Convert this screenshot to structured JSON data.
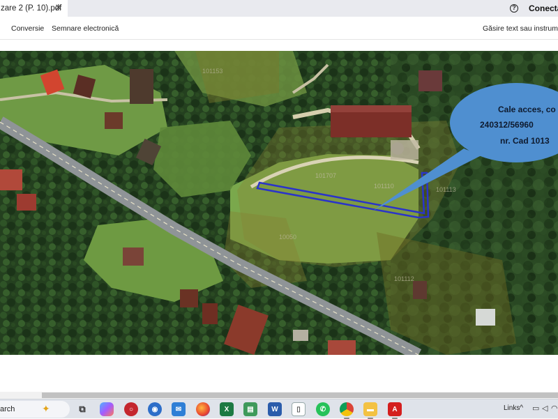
{
  "tab": {
    "title": "zare 2 (P. 10).pdf",
    "close_glyph": "✕"
  },
  "header": {
    "help_glyph": "?",
    "connect_label": "Conecta"
  },
  "toolbar": {
    "conversion": "Conversie",
    "esign": "Semnare electronică",
    "find": "Găsire text sau instrumente"
  },
  "map": {
    "callout_lines": [
      "Cale acces, co",
      "240312/56960",
      "nr. Cad 1013"
    ],
    "parcel_labels": [
      "101153",
      "101707",
      "101110",
      "101113",
      "10050",
      "101112"
    ],
    "access_path_color": "#2a34c9",
    "callout_color": "#4f8fd0"
  },
  "taskbar": {
    "search_label": "arch",
    "links_label": "Links",
    "apps": [
      {
        "name": "task-view-icon"
      },
      {
        "name": "copilot-icon"
      },
      {
        "name": "office-icon"
      },
      {
        "name": "camera-app-icon"
      },
      {
        "name": "outlook-icon"
      },
      {
        "name": "firefox-icon"
      },
      {
        "name": "excel-icon",
        "label": "X"
      },
      {
        "name": "sheets-icon"
      },
      {
        "name": "word-icon",
        "label": "W"
      },
      {
        "name": "file-icon"
      },
      {
        "name": "whatsapp-icon"
      },
      {
        "name": "chrome-icon"
      },
      {
        "name": "file-explorer-icon"
      },
      {
        "name": "acrobat-icon"
      }
    ]
  }
}
